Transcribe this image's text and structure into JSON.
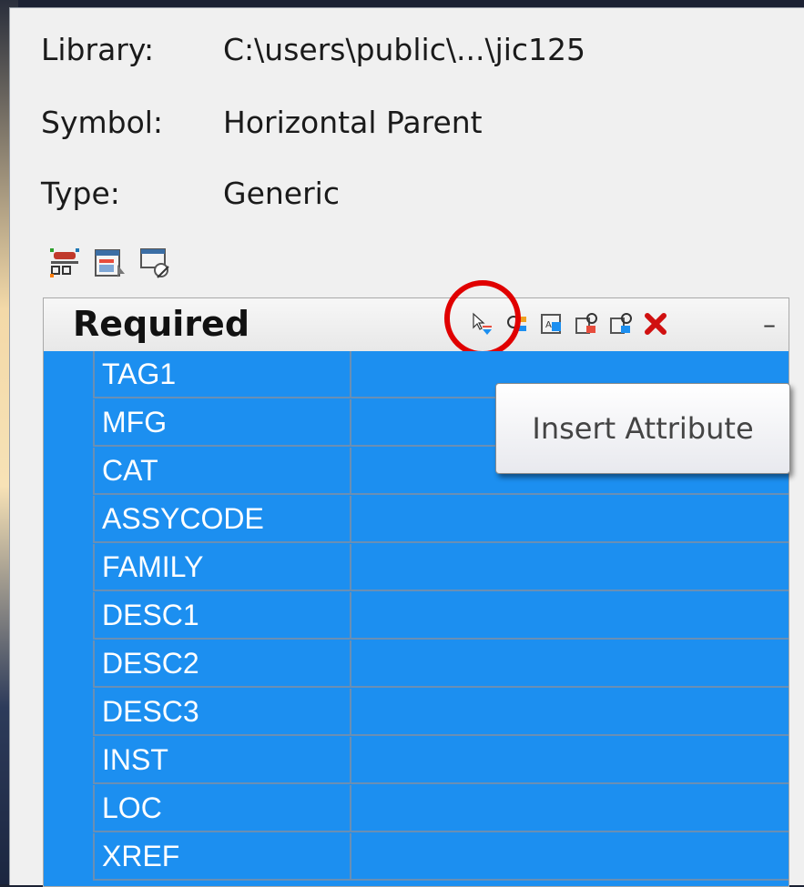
{
  "info": {
    "library_label": "Library:",
    "library_value": "C:\\users\\public\\...\\jic125",
    "symbol_label": "Symbol:",
    "symbol_value": "Horizontal Parent",
    "type_label": "Type:",
    "type_value": "Generic"
  },
  "top_toolbar": {
    "icons": [
      "attribute-template-icon",
      "insert-attribute-editor-icon",
      "properties-edit-icon"
    ]
  },
  "section": {
    "title": "Required",
    "collapse_glyph": "–",
    "header_icons": [
      "insert-attribute-icon",
      "move-attribute-icon",
      "rename-attribute-icon",
      "edit-attribute-icon",
      "hide-attribute-icon",
      "delete-attribute-icon"
    ],
    "rows": [
      {
        "name": "TAG1",
        "value": ""
      },
      {
        "name": "MFG",
        "value": ""
      },
      {
        "name": "CAT",
        "value": ""
      },
      {
        "name": "ASSYCODE",
        "value": ""
      },
      {
        "name": "FAMILY",
        "value": ""
      },
      {
        "name": "DESC1",
        "value": ""
      },
      {
        "name": "DESC2",
        "value": ""
      },
      {
        "name": "DESC3",
        "value": ""
      },
      {
        "name": "INST",
        "value": ""
      },
      {
        "name": "LOC",
        "value": ""
      },
      {
        "name": "XREF",
        "value": ""
      }
    ]
  },
  "tooltip": {
    "text": "Insert Attribute"
  },
  "colors": {
    "selection": "#1c8ff0",
    "highlight_circle": "#e00000",
    "delete_icon": "#d01010"
  }
}
